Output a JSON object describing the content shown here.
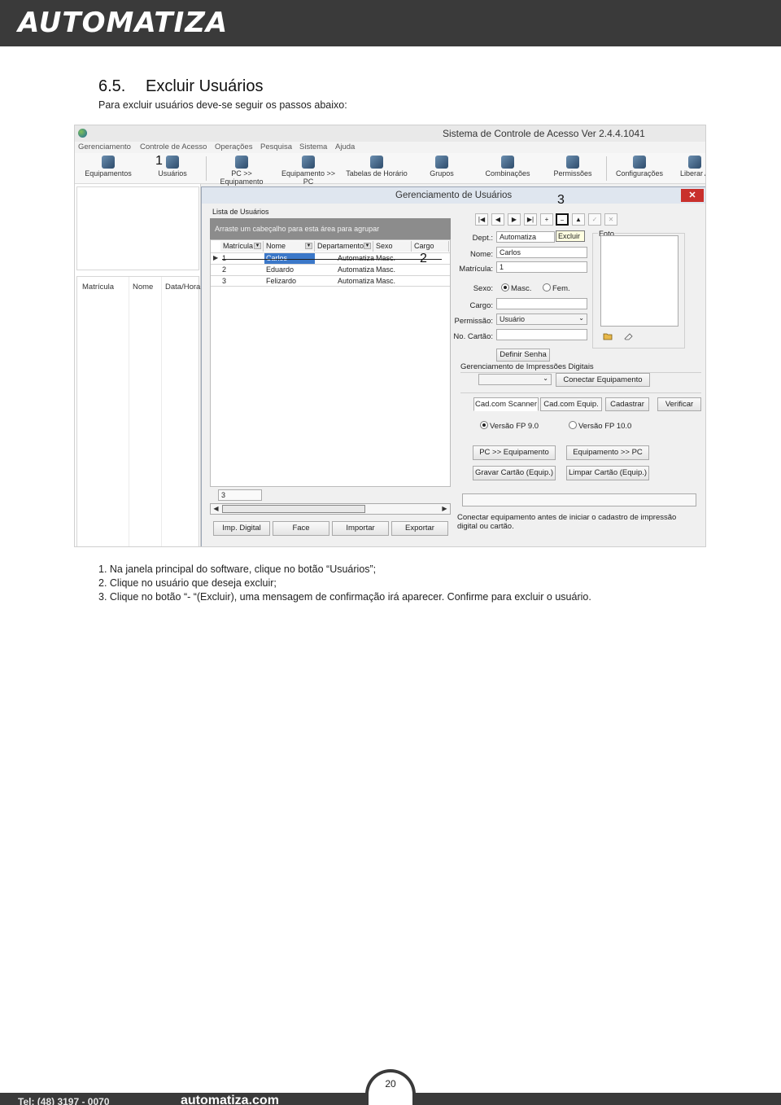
{
  "header": {
    "logo_text": "AUTOMATIZA"
  },
  "section": {
    "number": "6.5.",
    "title": "Excluir Usuários",
    "intro": "Para excluir usuários deve-se seguir os passos abaixo:"
  },
  "app": {
    "title": "Sistema de Controle de Acesso  Ver 2.4.4.1041",
    "menu": [
      "Gerenciamento",
      "Controle de Acesso",
      "Operações",
      "Pesquisa",
      "Sistema",
      "Ajuda"
    ],
    "toolbar": [
      "Equipamentos",
      "Usuários",
      "PC >> Equipamento",
      "Equipamento >> PC",
      "Tabelas de Horário",
      "Grupos",
      "Combinações",
      "Permissões",
      "Configurações",
      "Liberar A"
    ],
    "left_columns": [
      "Matrícula",
      "Nome",
      "Data/Hora"
    ]
  },
  "dialog": {
    "title": "Gerenciamento de Usuários",
    "close": "✕",
    "list_label": "Lista de Usuários",
    "group_hint": "Arraste um cabeçalho para esta área para agrupar",
    "columns": [
      "Matrícula",
      "Nome",
      "Departamento",
      "Sexo",
      "Cargo"
    ],
    "rows": [
      {
        "matricula": "1",
        "nome": "Carlos",
        "departamento": "Automatiza",
        "sexo": "Masc.",
        "cargo": ""
      },
      {
        "matricula": "2",
        "nome": "Eduardo",
        "departamento": "Automatiza",
        "sexo": "Masc.",
        "cargo": ""
      },
      {
        "matricula": "3",
        "nome": "Felizardo",
        "departamento": "Automatiza",
        "sexo": "Masc.",
        "cargo": ""
      }
    ],
    "count": "3",
    "bottom_buttons": [
      "Imp. Digital",
      "Face",
      "Importar",
      "Exportar"
    ],
    "nav_buttons": [
      "|◀",
      "◀",
      "▶",
      "▶|",
      "+",
      "−",
      "▲",
      "✓",
      "✕"
    ],
    "tooltip": "Excluir",
    "form": {
      "dept_label": "Dept.:",
      "dept_value": "Automatiza",
      "nome_label": "Nome:",
      "nome_value": "Carlos",
      "matricula_label": "Matrícula:",
      "matricula_value": "1",
      "sexo_label": "Sexo:",
      "sexo_masc": "Masc.",
      "sexo_fem": "Fem.",
      "cargo_label": "Cargo:",
      "cargo_value": "",
      "permissao_label": "Permissão:",
      "permissao_value": "Usuário",
      "cartao_label": "No. Cartão:",
      "cartao_value": "",
      "foto_label": "Foto",
      "definir_senha": "Definir Senha",
      "impressoes_label": "Gerenciamento de Impressões Digitais",
      "conectar": "Conectar Equipamento",
      "tabs": [
        "Cad.com Scanner",
        "Cad.com Equip.",
        "Cadastrar",
        "Verificar"
      ],
      "versao_9": "Versão FP 9.0",
      "versao_10": "Versão FP 10.0",
      "pc_equip": "PC >> Equipamento",
      "equip_pc": "Equipamento >> PC",
      "gravar": "Gravar Cartão (Equip.)",
      "limpar": "Limpar Cartão (Equip.)",
      "message": "Conectar equipamento antes de iniciar o cadastro de impressão digital ou cartão."
    }
  },
  "annotations": [
    "1",
    "2",
    "3"
  ],
  "steps": [
    "1. Na janela principal do software, clique no botão “Usuários”;",
    "2. Clique no usuário que deseja excluir;",
    "3. Clique no botão “- “(Excluir), uma mensagem de confirmação irá aparecer. Confirme para excluir o usuário."
  ],
  "footer": {
    "page_number": "20",
    "phone": "Tel: (48) 3197 - 0070",
    "site": "automatiza.com"
  }
}
